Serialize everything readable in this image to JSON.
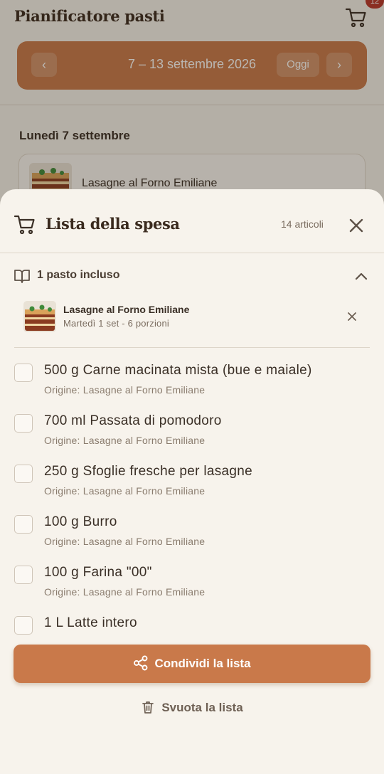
{
  "app": {
    "title": "Pianificatore pasti",
    "cart_badge": "12",
    "week_range": "7 – 13 settembre 2026",
    "today_label": "Oggi",
    "prev_icon": "chevron-left-icon",
    "next_icon": "chevron-right-icon",
    "day_title": "Lunedì 7 settembre",
    "day_meal": "Lasagne al Forno Emiliane"
  },
  "sheet": {
    "title": "Lista della spesa",
    "items_count": "14 articoli",
    "included_label": "1 pasto incluso",
    "meal": {
      "name": "Lasagne al Forno Emiliane",
      "meta": "Martedì 1 set  -  6 porzioni"
    },
    "items": [
      {
        "name": "500 g Carne macinata mista (bue e maiale)",
        "origin": "Origine: Lasagne al Forno Emiliane"
      },
      {
        "name": "700 ml Passata di pomodoro",
        "origin": "Origine: Lasagne al Forno Emiliane"
      },
      {
        "name": "250 g Sfoglie fresche per lasagne",
        "origin": "Origine: Lasagne al Forno Emiliane"
      },
      {
        "name": "100 g Burro",
        "origin": "Origine: Lasagne al Forno Emiliane"
      },
      {
        "name": "100 g Farina \"00\"",
        "origin": "Origine: Lasagne al Forno Emiliane"
      },
      {
        "name": "1 L Latte intero",
        "origin": ""
      }
    ],
    "share_label": "Condividi la lista",
    "clear_label": "Svuota la lista"
  },
  "colors": {
    "accent": "#c9794a",
    "badge": "#b8352a",
    "background": "#f7f3ec"
  }
}
